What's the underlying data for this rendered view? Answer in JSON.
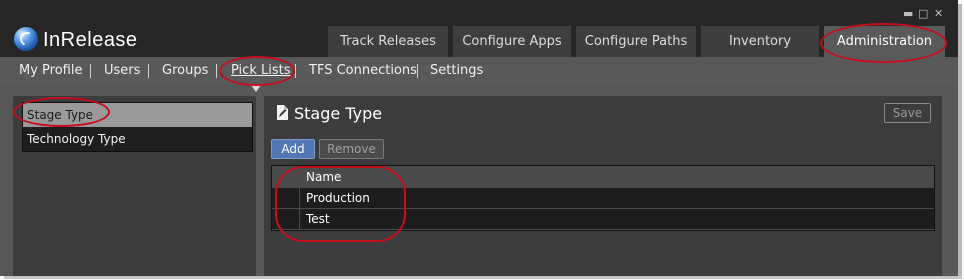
{
  "app": {
    "brand": "InRelease"
  },
  "window_controls": {
    "minimize": "▬",
    "maximize": "□",
    "close": "✕"
  },
  "top_tabs": [
    {
      "label": "Track Releases"
    },
    {
      "label": "Configure Apps"
    },
    {
      "label": "Configure Paths"
    },
    {
      "label": "Inventory"
    },
    {
      "label": "Administration",
      "active": true
    }
  ],
  "sub_nav": [
    {
      "label": "My Profile"
    },
    {
      "label": "Users"
    },
    {
      "label": "Groups"
    },
    {
      "label": "Pick Lists",
      "active": true
    },
    {
      "label": "TFS Connections"
    },
    {
      "label": "Settings"
    }
  ],
  "pick_lists": {
    "items": [
      {
        "label": "Stage Type",
        "selected": true
      },
      {
        "label": "Technology Type"
      }
    ]
  },
  "detail": {
    "title": "Stage Type",
    "icon": "document-pencil-icon",
    "save_label": "Save",
    "add_label": "Add",
    "remove_label": "Remove",
    "grid": {
      "columns": [
        "Name"
      ],
      "rows": [
        {
          "name": "Production"
        },
        {
          "name": "Test"
        }
      ]
    }
  },
  "colors": {
    "window_bg": "#2c2c2c",
    "nav_bg": "#595959",
    "accent_button": "#5277b5",
    "annotation": "#c4101a"
  }
}
